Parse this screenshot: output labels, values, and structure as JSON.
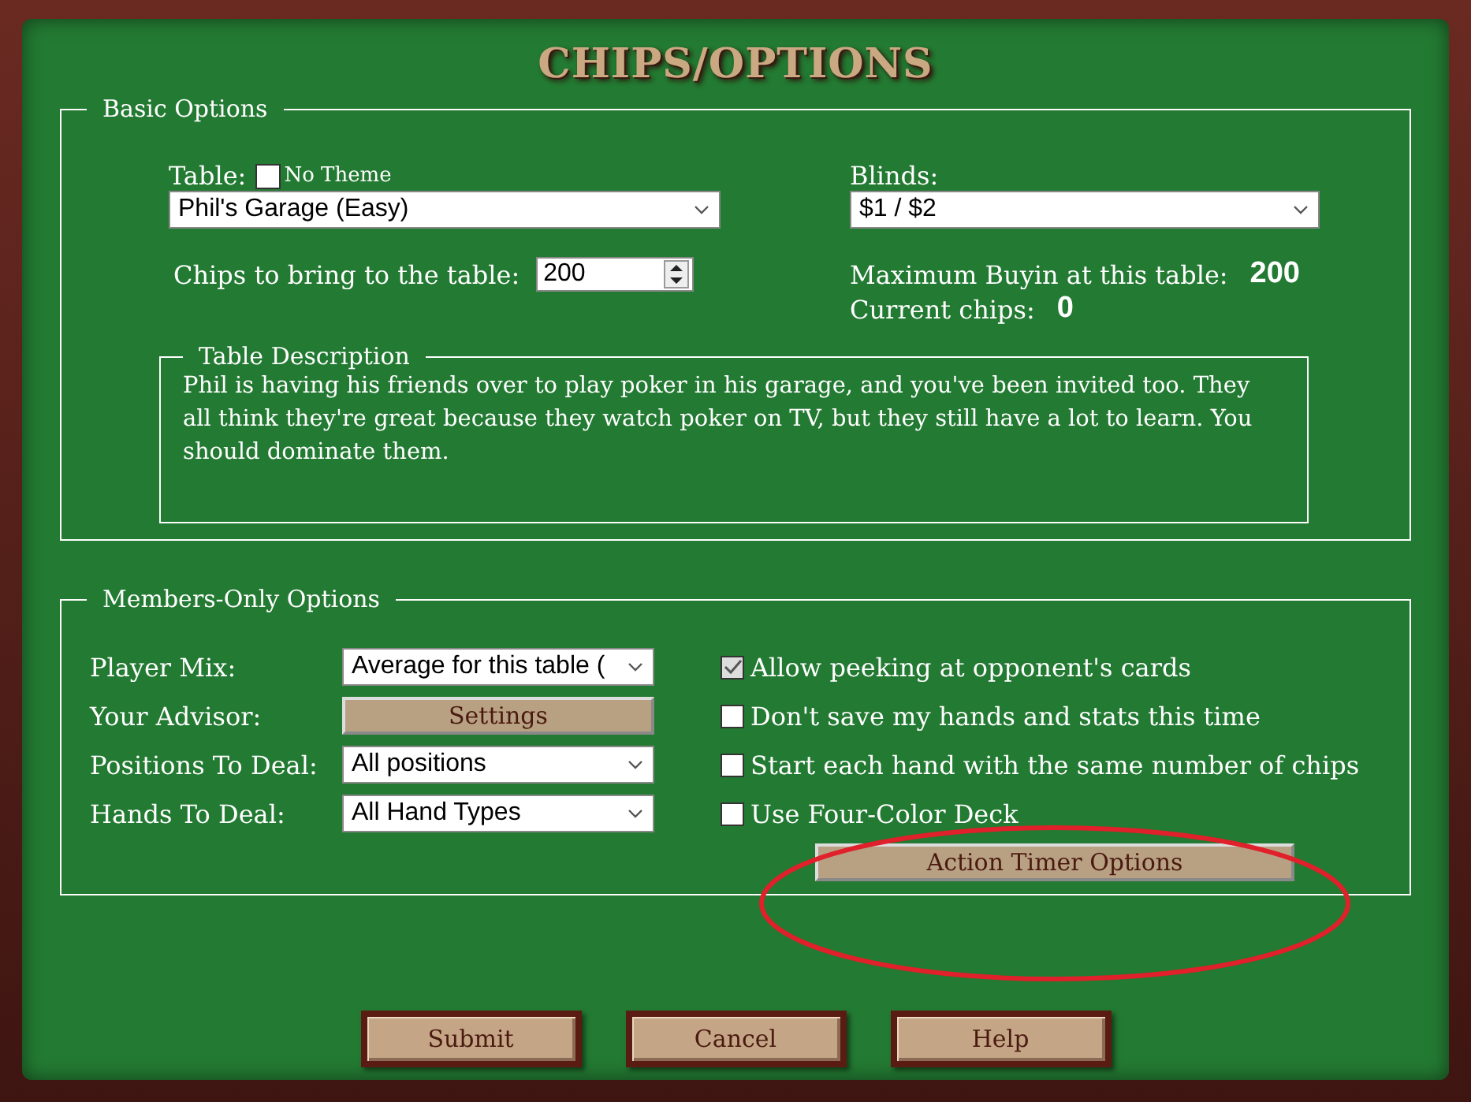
{
  "title": "CHIPS/OPTIONS",
  "basic_options": {
    "legend": "Basic Options",
    "table_label": "Table:",
    "no_theme": {
      "label": "No Theme",
      "checked": false
    },
    "table_select": "Phil's Garage (Easy)",
    "chips_label": "Chips to bring to the table:",
    "chips_value": "200",
    "blinds_label": "Blinds:",
    "blinds_select": "$1 / $2",
    "max_buyin_label": "Maximum Buyin at this table:",
    "max_buyin_value": "200",
    "current_chips_label": "Current chips:",
    "current_chips_value": "0",
    "description": {
      "legend": "Table Description",
      "text": "Phil is having his friends over to play poker in his garage, and you've been invited too. They all think they're great because they watch poker on TV, but they still have a lot to learn. You should dominate them."
    }
  },
  "members_options": {
    "legend": "Members-Only Options",
    "fields": [
      {
        "kind": "select",
        "label": "Player Mix:",
        "value": "Average for this table ("
      },
      {
        "kind": "button",
        "label": "Your Advisor:",
        "value": "Settings"
      },
      {
        "kind": "select",
        "label": "Positions To Deal:",
        "value": "All positions"
      },
      {
        "kind": "select",
        "label": "Hands To Deal:",
        "value": "All Hand Types"
      }
    ],
    "checkboxes": [
      {
        "label": "Allow peeking at opponent's cards",
        "checked": true
      },
      {
        "label": "Don't save my hands and stats this time",
        "checked": false
      },
      {
        "label": "Start each hand with the same number of chips",
        "checked": false
      },
      {
        "label": "Use Four-Color Deck",
        "checked": false
      }
    ],
    "action_button": "Action Timer Options"
  },
  "buttons": [
    "Submit",
    "Cancel",
    "Help"
  ]
}
